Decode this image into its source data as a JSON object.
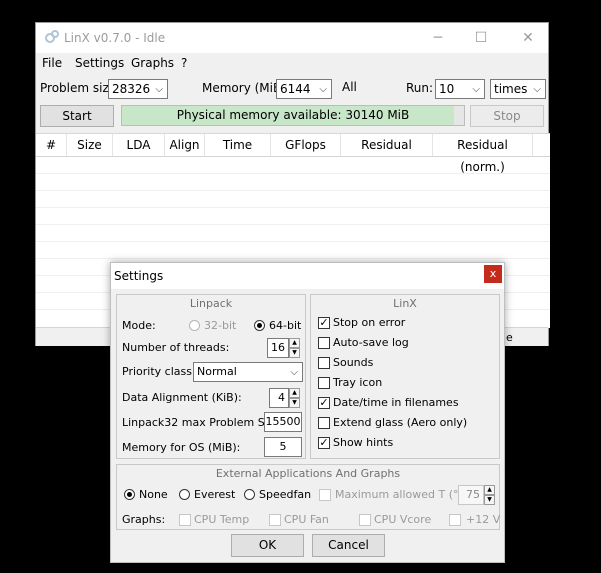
{
  "main": {
    "title": "LinX v0.7.0 - Idle",
    "menu": [
      "File",
      "Settings",
      "Graphs",
      "?"
    ],
    "problem_size_label": "Problem size:",
    "problem_size_value": "28326",
    "memory_label": "Memory (MiB):",
    "memory_value": "6144",
    "all_label": "All",
    "run_label": "Run:",
    "run_value": "10",
    "run_unit": "times",
    "start_label": "Start",
    "stop_label": "Stop",
    "progress_text": "Physical memory available: 30140 MiB",
    "progress_fraction": 0.97,
    "columns": [
      "#",
      "Size",
      "LDA",
      "Align",
      "Time",
      "GFlops",
      "Residual",
      "Residual (norm.)"
    ],
    "partial_hidden_text": "e"
  },
  "settings": {
    "title": "Settings",
    "linpack": {
      "title": "Linpack",
      "mode_label": "Mode:",
      "mode_32": "32-bit",
      "mode_64": "64-bit",
      "threads_label": "Number of threads:",
      "threads_value": "16",
      "priority_label": "Priority class:",
      "priority_value": "Normal",
      "alignment_label": "Data Alignment (KiB):",
      "alignment_value": "4",
      "max_size_label": "Linpack32 max Problem Size:",
      "max_size_value": "15500",
      "os_mem_label": "Memory for OS (MiB):",
      "os_mem_value": "5"
    },
    "linx": {
      "title": "LinX",
      "options": [
        {
          "label": "Stop on error",
          "checked": true
        },
        {
          "label": "Auto-save log",
          "checked": false
        },
        {
          "label": "Sounds",
          "checked": false
        },
        {
          "label": "Tray icon",
          "checked": false
        },
        {
          "label": "Date/time in filenames",
          "checked": true
        },
        {
          "label": "Extend glass (Aero only)",
          "checked": false
        },
        {
          "label": "Show hints",
          "checked": true
        }
      ]
    },
    "external": {
      "title": "External Applications And Graphs",
      "none": "None",
      "everest": "Everest",
      "speedfan": "Speedfan",
      "max_temp_label": "Maximum allowed T (°C):",
      "max_temp_value": "75",
      "graphs_label": "Graphs:",
      "cpu_temp": "CPU Temp",
      "cpu_fan": "CPU Fan",
      "cpu_vcore": "CPU Vcore",
      "v12": "+12 V"
    },
    "ok_label": "OK",
    "cancel_label": "Cancel",
    "close_symbol": "x"
  },
  "colors": {
    "progress_fill": "#c8e6c8",
    "close_button": "#c42b1c"
  }
}
